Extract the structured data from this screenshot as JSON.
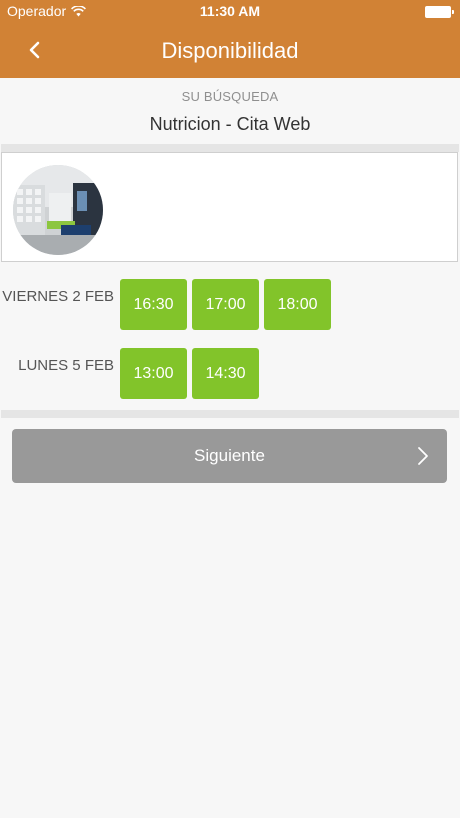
{
  "status_bar": {
    "carrier": "Operador",
    "time": "11:30 AM"
  },
  "nav": {
    "title": "Disponibilidad",
    "back_icon": "chevron-left-icon"
  },
  "search": {
    "caption": "SU BÚSQUEDA",
    "value": "Nutricion - Cita Web"
  },
  "provider": {
    "avatar_icon": "clinic-photo"
  },
  "days": [
    {
      "label": "VIERNES 2 FEB",
      "slots": [
        "16:30",
        "17:00",
        "18:00"
      ]
    },
    {
      "label": "LUNES 5 FEB",
      "slots": [
        "13:00",
        "14:30"
      ]
    }
  ],
  "next_button": {
    "label": "Siguiente",
    "icon": "chevron-right-icon"
  },
  "colors": {
    "header": "#d18235",
    "slot": "#82c42a",
    "button": "#999999"
  }
}
